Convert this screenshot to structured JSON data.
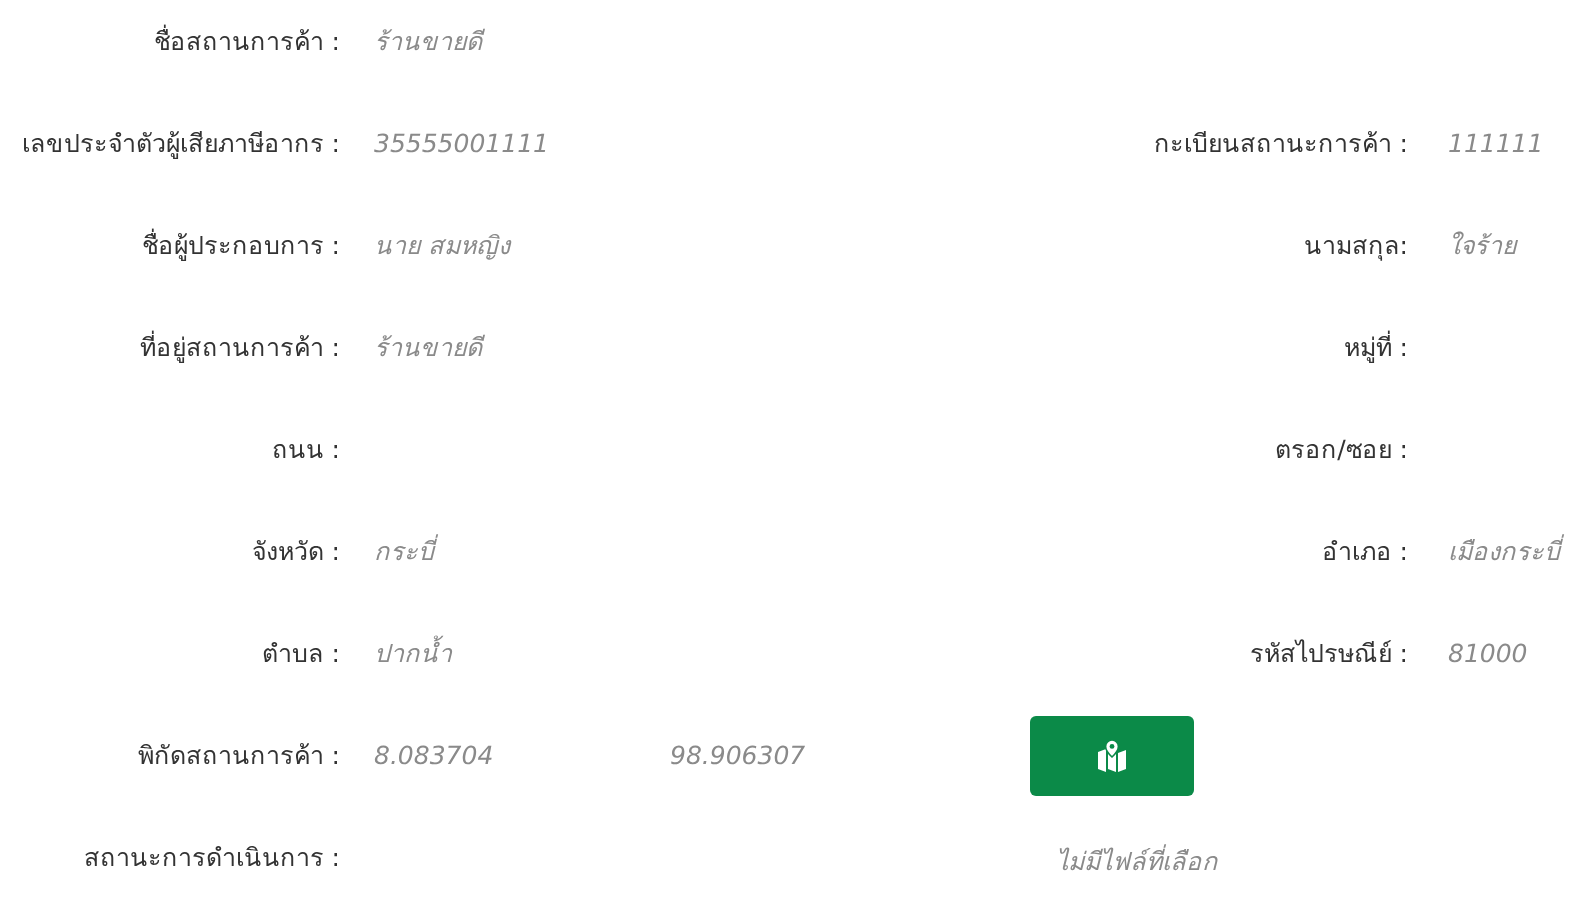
{
  "rows": [
    {
      "kind": "pair",
      "left": {
        "label": "ชื่อสถานการค้า :",
        "value": "ร้านขายดี"
      }
    },
    {
      "kind": "pair",
      "left": {
        "label": "เลขประจำตัวผู้เสียภาษีอากร :",
        "value": "35555001111"
      },
      "right": {
        "label": "กะเบียนสถานะการค้า :",
        "value": "111111"
      }
    },
    {
      "kind": "pair",
      "left": {
        "label": "ชื่อผู้ประกอบการ :",
        "value": "นาย สมหญิง"
      },
      "right": {
        "label": "นามสกุล:",
        "value": "ใจร้าย"
      }
    },
    {
      "kind": "pair",
      "left": {
        "label": "ที่อยู่สถานการค้า :",
        "value": "ร้านขายดี"
      },
      "right": {
        "label": "หมู่ที่ :"
      }
    },
    {
      "kind": "pair",
      "left": {
        "label": "ถนน :"
      },
      "right": {
        "label": "ตรอก/ซอย :"
      }
    },
    {
      "kind": "pair",
      "left": {
        "label": "จังหวัด :",
        "value": "กระบี่"
      },
      "right": {
        "label": "อำเภอ :",
        "value": "เมืองกระบี่"
      }
    },
    {
      "kind": "pair",
      "left": {
        "label": "ตำบล :",
        "value": "ปากน้ำ"
      },
      "right": {
        "label": "รหัสไปรษณีย์ :",
        "value": "81000"
      }
    },
    {
      "kind": "coords",
      "label": "พิกัดสถานการค้า :",
      "latitude": "8.083704",
      "longitude": "98.906307"
    },
    {
      "kind": "file",
      "label": "สถานะการดำเนินการ :",
      "file_status": "ไม่มีไฟล์ที่เลือก"
    }
  ]
}
